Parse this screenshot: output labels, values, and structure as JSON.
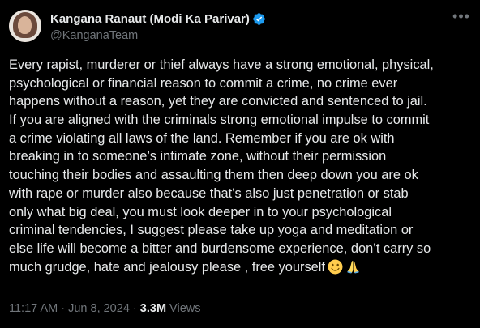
{
  "author": {
    "name": "Kangana Ranaut (Modi Ka Parivar)",
    "handle": "@KanganaTeam"
  },
  "tweet": {
    "lines": [
      "Every rapist, murderer or thief always have a strong emotional, physical,",
      "psychological or financial reason to commit a crime, no crime ever",
      "happens without a reason, yet they are convicted and sentenced to jail.",
      "If you are aligned with the criminals strong emotional impulse to commit",
      "a crime violating all laws of the land. Remember if you are ok with",
      "breaking in to someone’s intimate zone, without their permission",
      "touching their bodies and assaulting them then deep down you are ok",
      "with rape or murder also because that’s also just penetration or stab",
      "only what big deal, you must look deeper in to your psychological",
      "criminal tendencies, I suggest please take up yoga and meditation or",
      "else life will become a bitter and burdensome experience, don’t carry so",
      "much grudge, hate and jealousy please , free yourself"
    ],
    "emojis": [
      "slightly-smiling-face-emoji",
      "folded-hands-emoji"
    ]
  },
  "meta": {
    "time": "11:17 AM",
    "separator1": " · ",
    "date": "Jun 8, 2024",
    "separator2": " · ",
    "views_count": "3.3M",
    "views_label": " Views"
  },
  "colors": {
    "background": "#000000",
    "text": "#e7e9ea",
    "secondary": "#71767b",
    "verified": "#1d9bf0"
  }
}
